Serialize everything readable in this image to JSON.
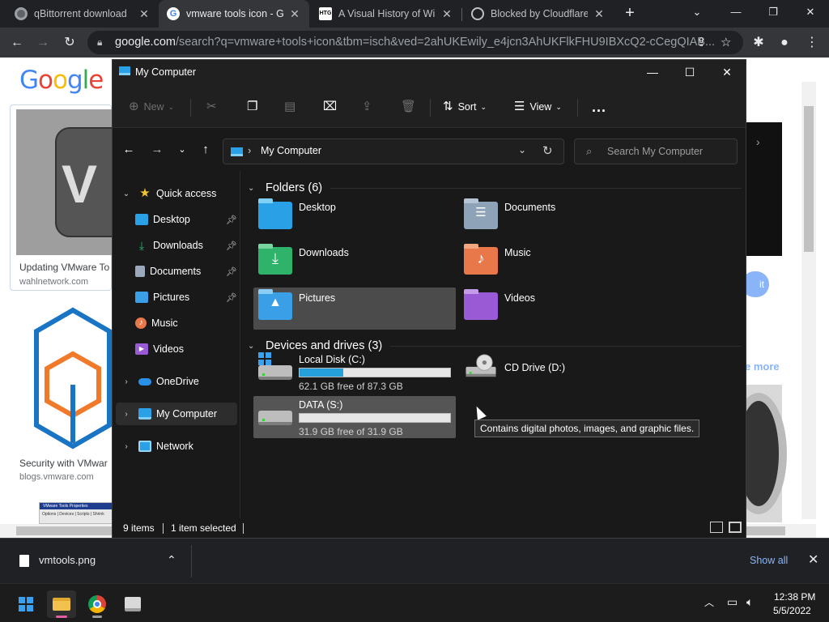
{
  "browser": {
    "tabs": [
      {
        "title": "qBittorrent download",
        "active": false
      },
      {
        "title": "vmware tools icon - Go",
        "active": true
      },
      {
        "title": "A Visual History of Win",
        "active": false
      },
      {
        "title": "Blocked by Cloudflare",
        "active": false
      }
    ],
    "new_tab": "+",
    "url_host": "google.com",
    "url_path": "/search?q=vmware+tools+icon&tbm=isch&ved=2ahUKEwily_e4jcn3AhUKFlkFHU9IBXcQ2-cCegQIAB..."
  },
  "google_page": {
    "logo": "Google",
    "results": [
      {
        "caption": "Updating VMware To",
        "source": "wahlnetwork.com"
      },
      {
        "caption": "Security with VMwar",
        "source": "blogs.vmware.com"
      }
    ],
    "side_button": "it",
    "see_more": "e more",
    "thumb_label": "VMware Tools Properties",
    "thumb_tabs": "Options | Devices | Scripts | Shrink"
  },
  "explorer": {
    "title": "My Computer",
    "toolbar": {
      "new": "New",
      "sort": "Sort",
      "view": "View",
      "more": "..."
    },
    "address": {
      "path": "My Computer",
      "search_placeholder": "Search My Computer"
    },
    "nav": [
      {
        "label": "Quick access",
        "icon": "star-icon"
      },
      {
        "label": "Desktop",
        "icon": "desktop-icon",
        "pinned": true
      },
      {
        "label": "Downloads",
        "icon": "download-icon",
        "pinned": true
      },
      {
        "label": "Documents",
        "icon": "document-icon",
        "pinned": true
      },
      {
        "label": "Pictures",
        "icon": "pictures-icon",
        "pinned": true
      },
      {
        "label": "Music",
        "icon": "music-icon"
      },
      {
        "label": "Videos",
        "icon": "videos-icon"
      },
      {
        "label": "OneDrive",
        "icon": "cloud-icon"
      },
      {
        "label": "My Computer",
        "icon": "computer-icon",
        "selected": true
      },
      {
        "label": "Network",
        "icon": "network-icon"
      }
    ],
    "folders_header": "Folders (6)",
    "folders": [
      {
        "name": "Desktop",
        "color": "#2aa0e6"
      },
      {
        "name": "Documents",
        "color": "#8fa3b8"
      },
      {
        "name": "Downloads",
        "color": "#2fb36b"
      },
      {
        "name": "Music",
        "color": "#e8784a"
      },
      {
        "name": "Pictures",
        "color": "#3a9fe6"
      },
      {
        "name": "Videos",
        "color": "#9a5ad6"
      }
    ],
    "drives_header": "Devices and drives (3)",
    "drives": [
      {
        "name": "Local Disk (C:)",
        "free": "62.1 GB free of 87.3 GB",
        "used_fraction": 0.289
      },
      {
        "name": "CD Drive (D:)"
      },
      {
        "name": "DATA (S:)",
        "free": "31.9 GB free of 31.9 GB",
        "used_fraction": 0.0
      }
    ],
    "tooltip": "Contains digital photos, images, and graphic files.",
    "status": {
      "items": "9 items",
      "selected": "1 item selected"
    }
  },
  "download_shelf": {
    "file": "vmtools.png",
    "show_all": "Show all"
  },
  "taskbar": {
    "time": "12:38 PM",
    "date": "5/5/2022"
  }
}
